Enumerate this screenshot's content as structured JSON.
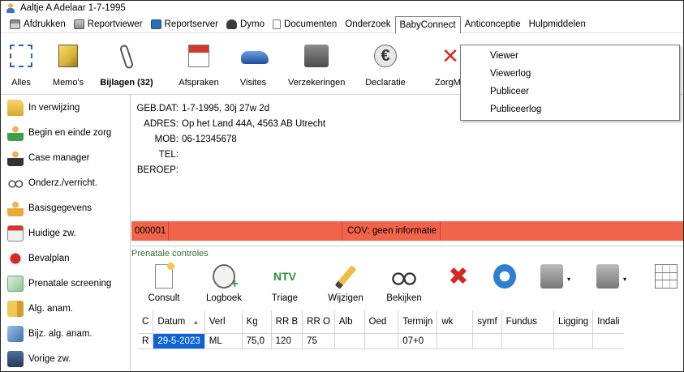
{
  "window": {
    "title": "Aaltje A Adelaar 1-7-1995"
  },
  "menu": [
    {
      "label": "Afdrukken",
      "icon": "print-icon"
    },
    {
      "label": "Reportviewer",
      "icon": "report-icon"
    },
    {
      "label": "Reportserver",
      "icon": "server-icon"
    },
    {
      "label": "Dymo",
      "icon": "dymo-icon"
    },
    {
      "label": "Documenten",
      "icon": "document-icon"
    },
    {
      "label": "Onderzoek"
    },
    {
      "label": "BabyConnect"
    },
    {
      "label": "Anticonceptie"
    },
    {
      "label": "Hulpmiddelen"
    }
  ],
  "dropdown": {
    "items": [
      "Viewer",
      "Viewerlog",
      "Publiceer",
      "Publiceerlog"
    ]
  },
  "toolbar": [
    {
      "label": "Alles",
      "icon": "select-all-icon",
      "bold": false
    },
    {
      "label": "Memo's",
      "icon": "memo-icon",
      "bold": false
    },
    {
      "label": "Bijlagen (32)",
      "icon": "paperclip-icon",
      "bold": true
    },
    {
      "label": "Afspraken",
      "icon": "calendar-icon",
      "bold": false
    },
    {
      "label": "Visites",
      "icon": "car-icon",
      "bold": false
    },
    {
      "label": "Verzekeringen",
      "icon": "cash-register-icon",
      "bold": false
    },
    {
      "label": "Declaratie",
      "icon": "euro-icon",
      "bold": false
    },
    {
      "label": "ZorgMa",
      "icon": "delete-icon",
      "bold": false
    }
  ],
  "sidebar": {
    "items": [
      {
        "label": "In verwijzing",
        "icon": "folder-icon"
      },
      {
        "label": "Begin en einde zorg",
        "icon": "person-green-icon"
      },
      {
        "label": "Case manager",
        "icon": "person-dark-icon"
      },
      {
        "label": "Onderz./verricht.",
        "icon": "glasses-icon"
      },
      {
        "label": "Basisgegevens",
        "icon": "person-icon"
      },
      {
        "label": "Huidige zw.",
        "icon": "calendar-icon"
      },
      {
        "label": "Bevalplan",
        "icon": "heart-icon"
      },
      {
        "label": "Prenatale screening",
        "icon": "chart-icon"
      },
      {
        "label": "Alg. anam.",
        "icon": "book-icon"
      },
      {
        "label": "Bijz. alg. anam.",
        "icon": "books-icon"
      },
      {
        "label": "Vorige zw.",
        "icon": "pregnancy-icon"
      }
    ]
  },
  "patient": {
    "rows": [
      {
        "key": "GEB.DAT:",
        "value": "1-7-1995, 30j 27w 2d"
      },
      {
        "key": "ADRES:",
        "value": "Op het Land 44A, 4563 AB  Utrecht"
      },
      {
        "key": "MOB:",
        "value": "06-12345678"
      },
      {
        "key": "TEL:",
        "value": ""
      },
      {
        "key": "BEROEP:",
        "value": ""
      }
    ]
  },
  "status": {
    "code": "000001",
    "cov": "COV: geen informatie",
    "color": "#f26449"
  },
  "prenatal": {
    "title": "Prenatale controles",
    "buttons": [
      "Consult",
      "Logboek",
      "Triage",
      "Wijzigen",
      "Bekijken"
    ],
    "ntv_label": "NTV",
    "columns": [
      "C",
      "Datum",
      "Verl",
      "Kg",
      "RR B",
      "RR O",
      "Alb",
      "Oed",
      "Termijn",
      "wk",
      "symf",
      "Fundus",
      "Ligging",
      "Indali"
    ],
    "rows": [
      [
        "R",
        "29-5-2023",
        "ML",
        "75,0",
        "120",
        "75",
        "",
        "",
        "07+0",
        "",
        "",
        "",
        "",
        ""
      ]
    ]
  },
  "colors": {
    "selection": "#0d63d6",
    "accent_green": "#2e8b3d"
  }
}
